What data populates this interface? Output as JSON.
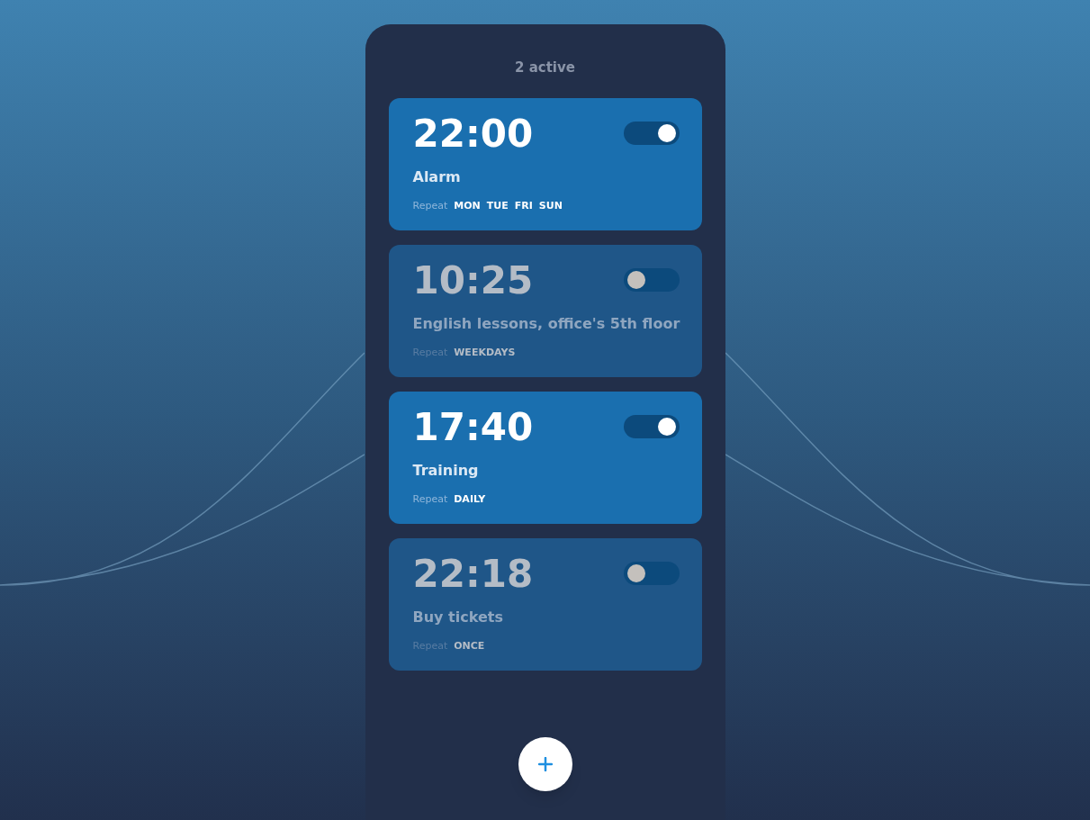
{
  "header": {
    "summary": "2 active"
  },
  "alarms": [
    {
      "time": "22:00",
      "label": "Alarm",
      "repeat_label": "Repeat",
      "days": [
        "MON",
        "TUE",
        "FRI",
        "SUN"
      ],
      "on": true
    },
    {
      "time": "10:25",
      "label": "English lessons, office's 5th floor",
      "repeat_label": "Repeat",
      "days": [
        "WEEKDAYS"
      ],
      "on": false
    },
    {
      "time": "17:40",
      "label": "Training",
      "repeat_label": "Repeat",
      "days": [
        "DAILY"
      ],
      "on": true
    },
    {
      "time": "22:18",
      "label": "Buy tickets",
      "repeat_label": "Repeat",
      "days": [
        "ONCE"
      ],
      "on": false
    }
  ]
}
